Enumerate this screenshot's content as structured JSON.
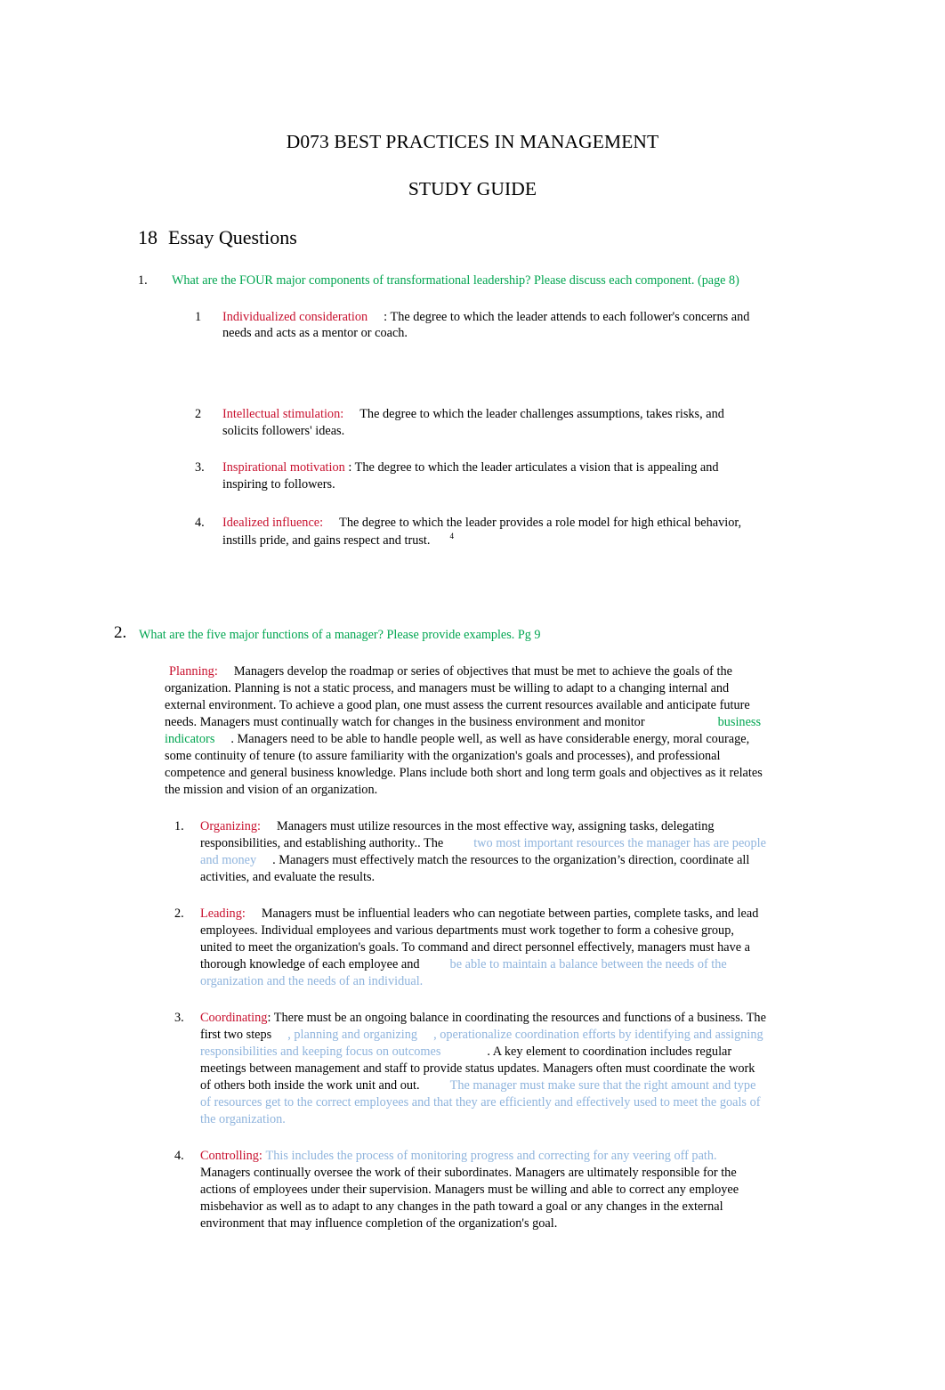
{
  "document": {
    "title": "D073 BEST PRACTICES IN MANAGEMENT",
    "subtitle": "STUDY GUIDE",
    "section_number": "18",
    "section_title": "Essay Questions"
  },
  "colors": {
    "question_green": "#00A550",
    "term_red": "#C8102E",
    "highlight_blue": "#8FB4DD",
    "body_black": "#000000",
    "page_background": "#FFFFFF"
  },
  "questions": [
    {
      "marker": "1.",
      "prompt": "What are the FOUR major components of transformational leadership? Please discuss each component. (page 8)",
      "components": [
        {
          "marker": "1",
          "term": "Individualized consideration",
          "body": ": The degree to which the leader attends to each follower's concerns and needs and acts as a mentor or coach.",
          "superscript": ""
        },
        {
          "marker": "2",
          "term": "Intellectual stimulation:",
          "body": "The degree to which the leader challenges assumptions, takes risks, and solicits followers' ideas.",
          "superscript": ""
        },
        {
          "marker": "3.",
          "term": "Inspirational motivation",
          "body": ": The degree to which the leader articulates a vision that is appealing and inspiring to followers.",
          "superscript": ""
        },
        {
          "marker": "4.",
          "term": "Idealized influence:",
          "body": "The degree to which the leader provides a role model for high ethical behavior, instills pride, and gains respect and trust.",
          "superscript": "4"
        }
      ]
    },
    {
      "marker": "2.",
      "prompt": "What are the five major functions of a manager? Please provide examples. Pg 9",
      "planning": {
        "term": "Planning:",
        "body_part1": "Managers develop the roadmap or series of objectives that must be met to achieve the goals of the organization. Planning is not a static process, and managers must be willing to adapt to a changing internal and external environment. To achieve a good plan, one must assess the current resources available and anticipate future needs. Managers must continually watch for changes in the business environment and monitor",
        "highlight": "business indicators",
        "body_part2": ". Managers need to be able to handle people well, as well as have considerable energy, moral courage, some continuity of tenure (to assure familiarity with the organization's goals and processes), and professional competence and general business knowledge. Plans include both short and long term goals and objectives as it relates the mission and vision of an organization."
      },
      "functions": [
        {
          "marker": "1.",
          "term": "Organizing:",
          "body_part1": "Managers must utilize resources in the most effective way, assigning tasks, delegating responsibilities, and establishing authority.. The",
          "highlight1": "two most important resources the manager has are people and money",
          "body_part2": ". Managers must effectively match the resources to the organization’s direction, coordinate all activities, and evaluate the results.",
          "highlight2": "",
          "body_part3": ""
        },
        {
          "marker": "2.",
          "term": "Leading:",
          "body_part1": "Managers must be influential leaders who can negotiate between parties, complete tasks, and lead employees. Individual employees and various departments must work together to form a cohesive group, united to meet the organization's goals. To command and direct personnel effectively, managers must have a thorough knowledge of each employee and",
          "highlight1": "be able to maintain a balance between the needs of the organization and the needs of an individual.",
          "body_part2": "",
          "highlight2": "",
          "body_part3": ""
        },
        {
          "marker": "3.",
          "term": "Coordinating",
          "body_part1": ": There must be an ongoing balance in coordinating the resources and functions of a business. The first two steps",
          "highlight1": ", planning and organizing",
          "body_part2": "",
          "highlight_extra": ", operationalize coordination efforts by identifying and assigning responsibilities and keeping focus on outcomes",
          "body_part2b": ". A key element to coordination includes regular meetings between management and staff to provide status updates. Managers often must coordinate the work of others both inside the work unit and out.",
          "highlight2": "The manager must make sure that the right amount and type of resources get to the correct employees and that they are efficiently and effectively used to meet the goals of the organization.",
          "body_part3": ""
        },
        {
          "marker": "4.",
          "term": "Controlling:",
          "body_part1": "",
          "highlight1": "This includes the process of monitoring progress and correcting for any veering off path.",
          "body_part2": "Managers continually oversee the work of their subordinates. Managers are ultimately responsible for the actions of employees under their supervision. Managers must be willing and able to correct any employee misbehavior as well as to adapt to any changes in the path toward a goal or any changes in the external environment that may influence completion of the organization's goal.",
          "highlight2": "",
          "body_part3": ""
        }
      ]
    }
  ]
}
